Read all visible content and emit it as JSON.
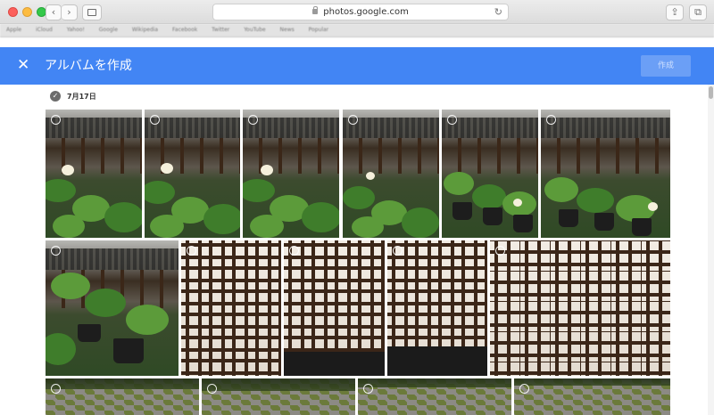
{
  "browser": {
    "url": "photos.google.com",
    "back_icon": "chevron-left-icon",
    "forward_icon": "chevron-right-icon",
    "reload_icon": "reload-icon",
    "bookmarks": [
      "Apple",
      "iCloud",
      "Yahoo!",
      "Google",
      "Wikipedia",
      "Facebook",
      "Twitter",
      "YouTube",
      "News",
      "Popular"
    ]
  },
  "header": {
    "close_label": "✕",
    "title": "アルバムを作成",
    "create_button": "作成",
    "accent_color": "#4285f4"
  },
  "section": {
    "date": "7月17日"
  }
}
